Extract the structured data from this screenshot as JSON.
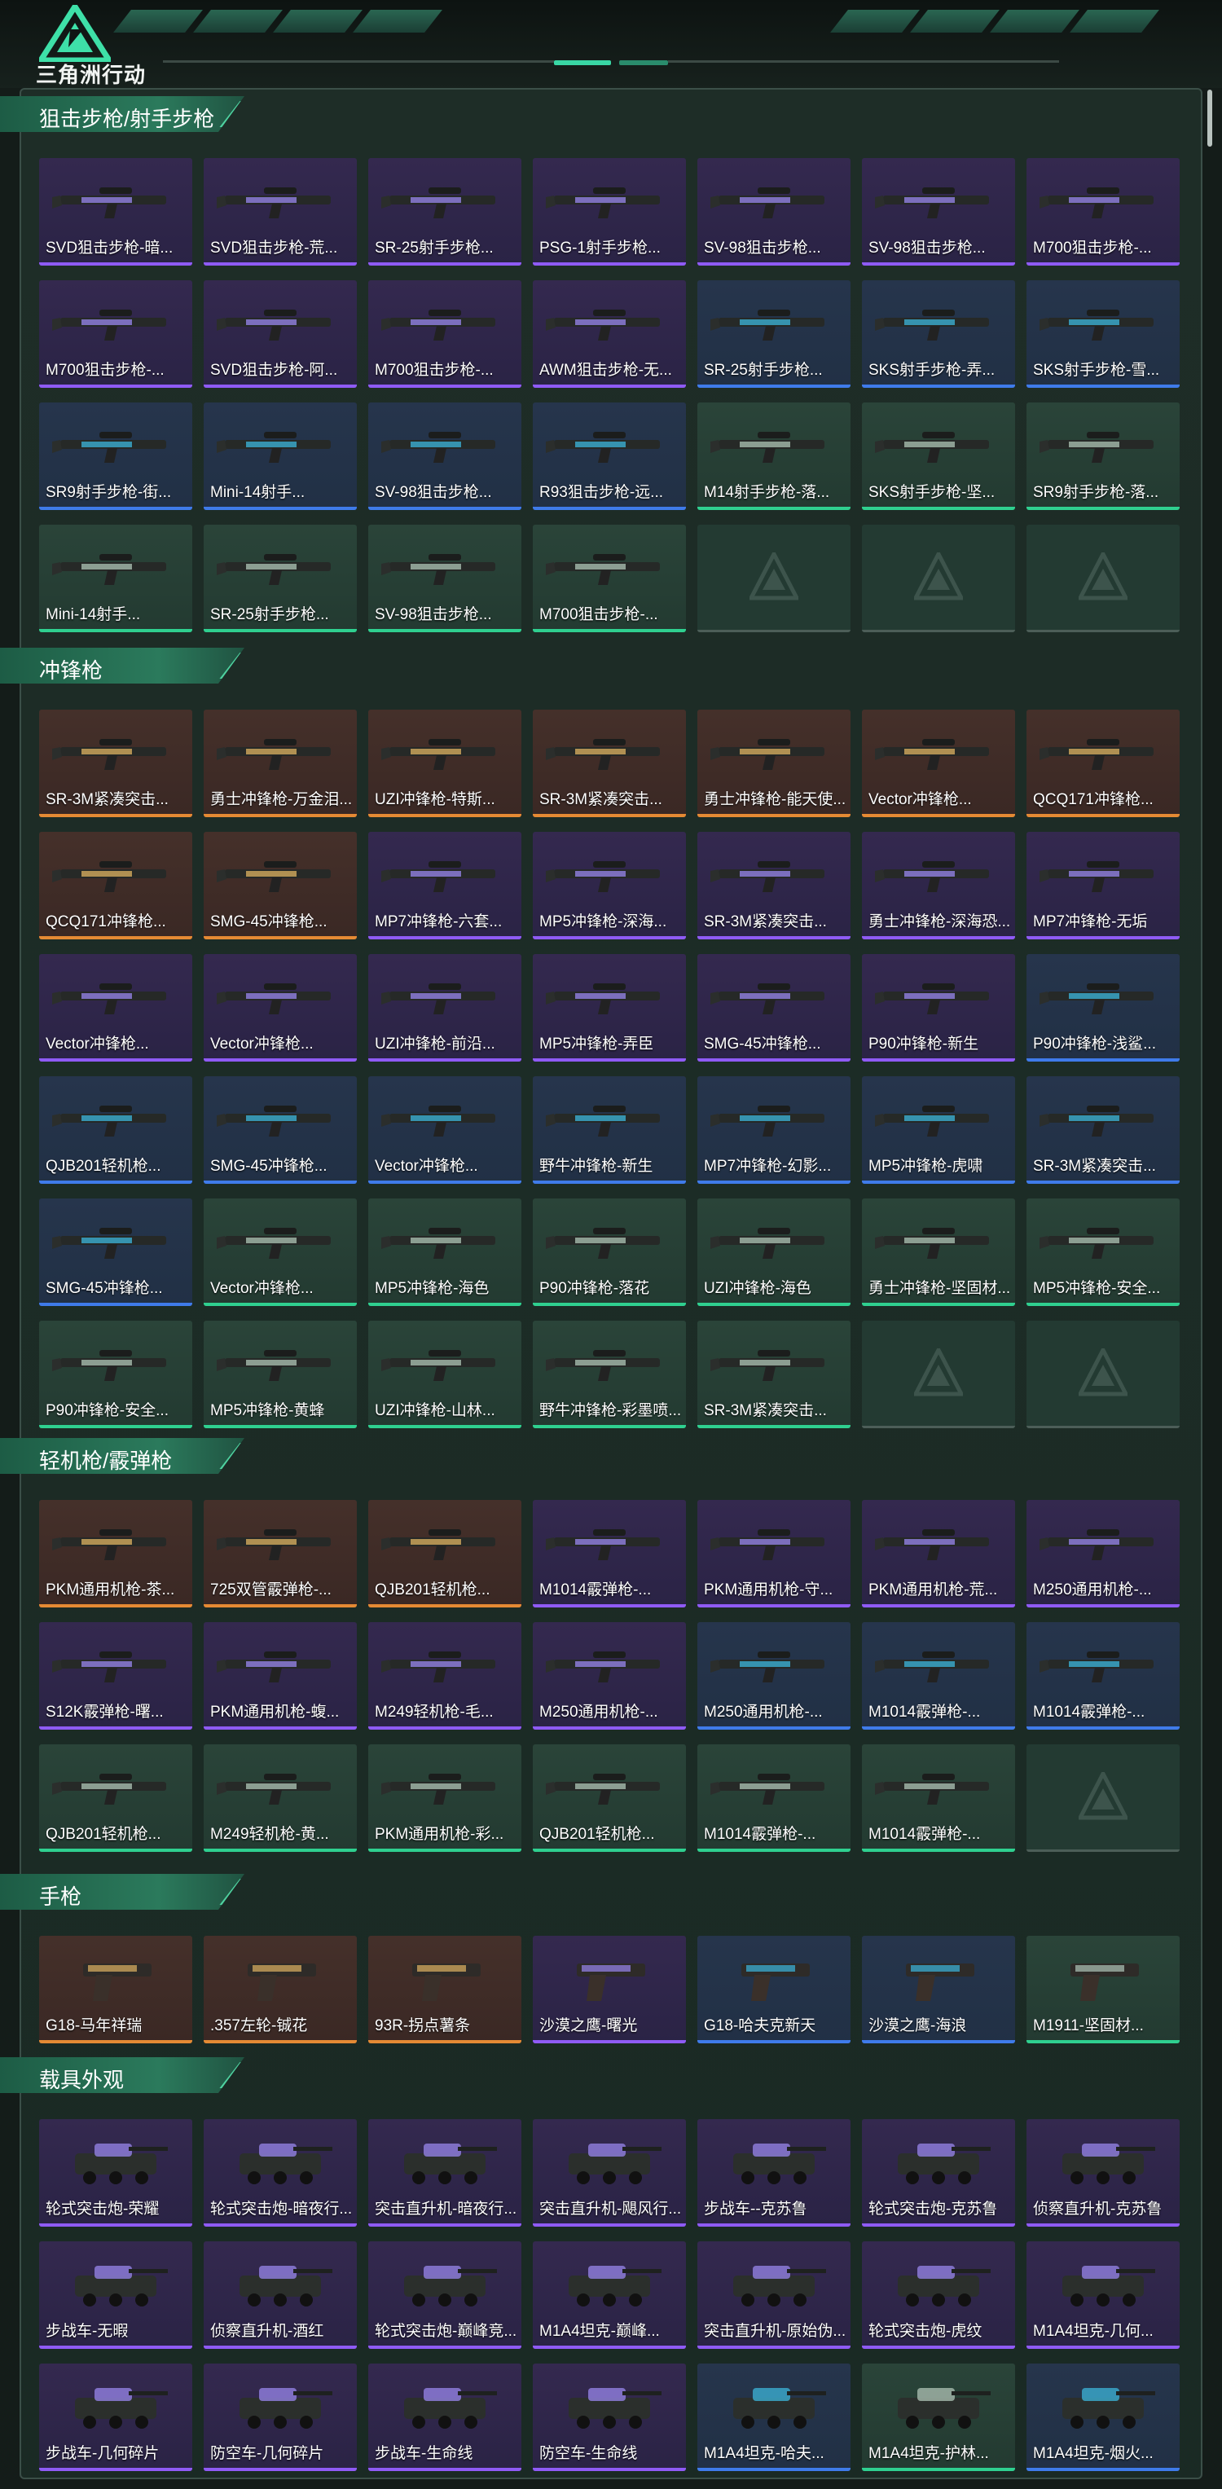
{
  "header": {
    "logo_text": "三角洲行动"
  },
  "colors": {
    "purple": "#8f5bf5",
    "orange": "#e58a34",
    "blue": "#3f7bea",
    "green": "#2fd090",
    "accent": "#39d7a4"
  },
  "sections": [
    {
      "title": "狙击步枪/射手步枪",
      "kind": "gun",
      "items": [
        {
          "label": "SVD狙击步枪-暗...",
          "rarity": "purple"
        },
        {
          "label": "SVD狙击步枪-荒...",
          "rarity": "purple"
        },
        {
          "label": "SR-25射手步枪...",
          "rarity": "purple"
        },
        {
          "label": "PSG-1射手步枪...",
          "rarity": "purple"
        },
        {
          "label": "SV-98狙击步枪...",
          "rarity": "purple"
        },
        {
          "label": "SV-98狙击步枪...",
          "rarity": "purple"
        },
        {
          "label": "M700狙击步枪-...",
          "rarity": "purple"
        },
        {
          "label": "M700狙击步枪-...",
          "rarity": "purple"
        },
        {
          "label": "SVD狙击步枪-阿...",
          "rarity": "purple"
        },
        {
          "label": "M700狙击步枪-...",
          "rarity": "purple"
        },
        {
          "label": "AWM狙击步枪-无...",
          "rarity": "purple"
        },
        {
          "label": "SR-25射手步枪...",
          "rarity": "blue"
        },
        {
          "label": "SKS射手步枪-弄...",
          "rarity": "blue"
        },
        {
          "label": "SKS射手步枪-雪...",
          "rarity": "blue"
        },
        {
          "label": "SR9射手步枪-街...",
          "rarity": "blue"
        },
        {
          "label": "Mini-14射手...",
          "rarity": "blue"
        },
        {
          "label": "SV-98狙击步枪...",
          "rarity": "blue"
        },
        {
          "label": "R93狙击步枪-远...",
          "rarity": "blue"
        },
        {
          "label": "M14射手步枪-落...",
          "rarity": "green"
        },
        {
          "label": "SKS射手步枪-坚...",
          "rarity": "green"
        },
        {
          "label": "SR9射手步枪-落...",
          "rarity": "green"
        },
        {
          "label": "Mini-14射手...",
          "rarity": "green"
        },
        {
          "label": "SR-25射手步枪...",
          "rarity": "green"
        },
        {
          "label": "SV-98狙击步枪...",
          "rarity": "green"
        },
        {
          "label": "M700狙击步枪-...",
          "rarity": "green"
        },
        {
          "label": "",
          "rarity": "empty"
        },
        {
          "label": "",
          "rarity": "empty"
        },
        {
          "label": "",
          "rarity": "empty"
        }
      ]
    },
    {
      "title": "冲锋枪",
      "kind": "gun",
      "items": [
        {
          "label": "SR-3M紧凑突击...",
          "rarity": "orange"
        },
        {
          "label": "勇士冲锋枪-万金泪...",
          "rarity": "orange"
        },
        {
          "label": "UZI冲锋枪-特斯...",
          "rarity": "orange"
        },
        {
          "label": "SR-3M紧凑突击...",
          "rarity": "orange"
        },
        {
          "label": "勇士冲锋枪-能天使...",
          "rarity": "orange"
        },
        {
          "label": "Vector冲锋枪...",
          "rarity": "orange"
        },
        {
          "label": "QCQ171冲锋枪...",
          "rarity": "orange"
        },
        {
          "label": "QCQ171冲锋枪...",
          "rarity": "orange"
        },
        {
          "label": "SMG-45冲锋枪...",
          "rarity": "orange"
        },
        {
          "label": "MP7冲锋枪-六套...",
          "rarity": "purple"
        },
        {
          "label": "MP5冲锋枪-深海...",
          "rarity": "purple"
        },
        {
          "label": "SR-3M紧凑突击...",
          "rarity": "purple"
        },
        {
          "label": "勇士冲锋枪-深海恐...",
          "rarity": "purple"
        },
        {
          "label": "MP7冲锋枪-无垢",
          "rarity": "purple"
        },
        {
          "label": "Vector冲锋枪...",
          "rarity": "purple"
        },
        {
          "label": "Vector冲锋枪...",
          "rarity": "purple"
        },
        {
          "label": "UZI冲锋枪-前沿...",
          "rarity": "purple"
        },
        {
          "label": "MP5冲锋枪-弄臣",
          "rarity": "purple"
        },
        {
          "label": "SMG-45冲锋枪...",
          "rarity": "purple"
        },
        {
          "label": "P90冲锋枪-新生",
          "rarity": "purple"
        },
        {
          "label": "P90冲锋枪-浅鲨...",
          "rarity": "blue"
        },
        {
          "label": "QJB201轻机枪...",
          "rarity": "blue"
        },
        {
          "label": "SMG-45冲锋枪...",
          "rarity": "blue"
        },
        {
          "label": "Vector冲锋枪...",
          "rarity": "blue"
        },
        {
          "label": "野牛冲锋枪-新生",
          "rarity": "blue"
        },
        {
          "label": "MP7冲锋枪-幻影...",
          "rarity": "blue"
        },
        {
          "label": "MP5冲锋枪-虎啸",
          "rarity": "blue"
        },
        {
          "label": "SR-3M紧凑突击...",
          "rarity": "blue"
        },
        {
          "label": "SMG-45冲锋枪...",
          "rarity": "blue"
        },
        {
          "label": "Vector冲锋枪...",
          "rarity": "green"
        },
        {
          "label": "MP5冲锋枪-海色",
          "rarity": "green"
        },
        {
          "label": "P90冲锋枪-落花",
          "rarity": "green"
        },
        {
          "label": "UZI冲锋枪-海色",
          "rarity": "green"
        },
        {
          "label": "勇士冲锋枪-坚固材...",
          "rarity": "green"
        },
        {
          "label": "MP5冲锋枪-安全...",
          "rarity": "green"
        },
        {
          "label": "P90冲锋枪-安全...",
          "rarity": "green"
        },
        {
          "label": "MP5冲锋枪-黄蜂",
          "rarity": "green"
        },
        {
          "label": "UZI冲锋枪-山林...",
          "rarity": "green"
        },
        {
          "label": "野牛冲锋枪-彩墨喷...",
          "rarity": "green"
        },
        {
          "label": "SR-3M紧凑突击...",
          "rarity": "green"
        },
        {
          "label": "",
          "rarity": "empty"
        },
        {
          "label": "",
          "rarity": "empty"
        }
      ]
    },
    {
      "title": "轻机枪/霰弹枪",
      "kind": "gun",
      "items": [
        {
          "label": "PKM通用机枪-茶...",
          "rarity": "orange"
        },
        {
          "label": "725双管霰弹枪-...",
          "rarity": "orange"
        },
        {
          "label": "QJB201轻机枪...",
          "rarity": "orange"
        },
        {
          "label": "M1014霰弹枪-...",
          "rarity": "purple"
        },
        {
          "label": "PKM通用机枪-守...",
          "rarity": "purple"
        },
        {
          "label": "PKM通用机枪-荒...",
          "rarity": "purple"
        },
        {
          "label": "M250通用机枪-...",
          "rarity": "purple"
        },
        {
          "label": "S12K霰弹枪-曙...",
          "rarity": "purple"
        },
        {
          "label": "PKM通用机枪-蝮...",
          "rarity": "purple"
        },
        {
          "label": "M249轻机枪-毛...",
          "rarity": "purple"
        },
        {
          "label": "M250通用机枪-...",
          "rarity": "purple"
        },
        {
          "label": "M250通用机枪-...",
          "rarity": "blue"
        },
        {
          "label": "M1014霰弹枪-...",
          "rarity": "blue"
        },
        {
          "label": "M1014霰弹枪-...",
          "rarity": "blue"
        },
        {
          "label": "QJB201轻机枪...",
          "rarity": "green"
        },
        {
          "label": "M249轻机枪-黄...",
          "rarity": "green"
        },
        {
          "label": "PKM通用机枪-彩...",
          "rarity": "green"
        },
        {
          "label": "QJB201轻机枪...",
          "rarity": "green"
        },
        {
          "label": "M1014霰弹枪-...",
          "rarity": "green"
        },
        {
          "label": "M1014霰弹枪-...",
          "rarity": "green"
        },
        {
          "label": "",
          "rarity": "empty"
        }
      ]
    },
    {
      "title": "手枪",
      "kind": "pistol",
      "items": [
        {
          "label": "G18-马年祥瑞",
          "rarity": "orange"
        },
        {
          "label": ".357左轮-铖花",
          "rarity": "orange"
        },
        {
          "label": "93R-拐点薯条",
          "rarity": "orange"
        },
        {
          "label": "沙漠之鹰-曙光",
          "rarity": "purple"
        },
        {
          "label": "G18-哈夫克新天",
          "rarity": "blue"
        },
        {
          "label": "沙漠之鹰-海浪",
          "rarity": "blue"
        },
        {
          "label": "M1911-坚固材...",
          "rarity": "green"
        }
      ]
    },
    {
      "title": "载具外观",
      "kind": "vehicle",
      "items": [
        {
          "label": "轮式突击炮-荣耀",
          "rarity": "purple"
        },
        {
          "label": "轮式突击炮-暗夜行...",
          "rarity": "purple"
        },
        {
          "label": "突击直升机-暗夜行...",
          "rarity": "purple"
        },
        {
          "label": "突击直升机-飓风行...",
          "rarity": "purple"
        },
        {
          "label": "步战车--克苏鲁",
          "rarity": "purple"
        },
        {
          "label": "轮式突击炮-克苏鲁",
          "rarity": "purple"
        },
        {
          "label": "侦察直升机-克苏鲁",
          "rarity": "purple"
        },
        {
          "label": "步战车-无暇",
          "rarity": "purple"
        },
        {
          "label": "侦察直升机-酒红",
          "rarity": "purple"
        },
        {
          "label": "轮式突击炮-巅峰竞...",
          "rarity": "purple"
        },
        {
          "label": "M1A4坦克-巅峰...",
          "rarity": "purple"
        },
        {
          "label": "突击直升机-原始伪...",
          "rarity": "purple"
        },
        {
          "label": "轮式突击炮-虎纹",
          "rarity": "purple"
        },
        {
          "label": "M1A4坦克-几何...",
          "rarity": "purple"
        },
        {
          "label": "步战车-几何碎片",
          "rarity": "purple"
        },
        {
          "label": "防空车-几何碎片",
          "rarity": "purple"
        },
        {
          "label": "步战车-生命线",
          "rarity": "purple"
        },
        {
          "label": "防空车-生命线",
          "rarity": "purple"
        },
        {
          "label": "M1A4坦克-哈夫...",
          "rarity": "blue"
        },
        {
          "label": "M1A4坦克-护林...",
          "rarity": "green"
        },
        {
          "label": "M1A4坦克-烟火...",
          "rarity": "blue"
        }
      ]
    }
  ]
}
